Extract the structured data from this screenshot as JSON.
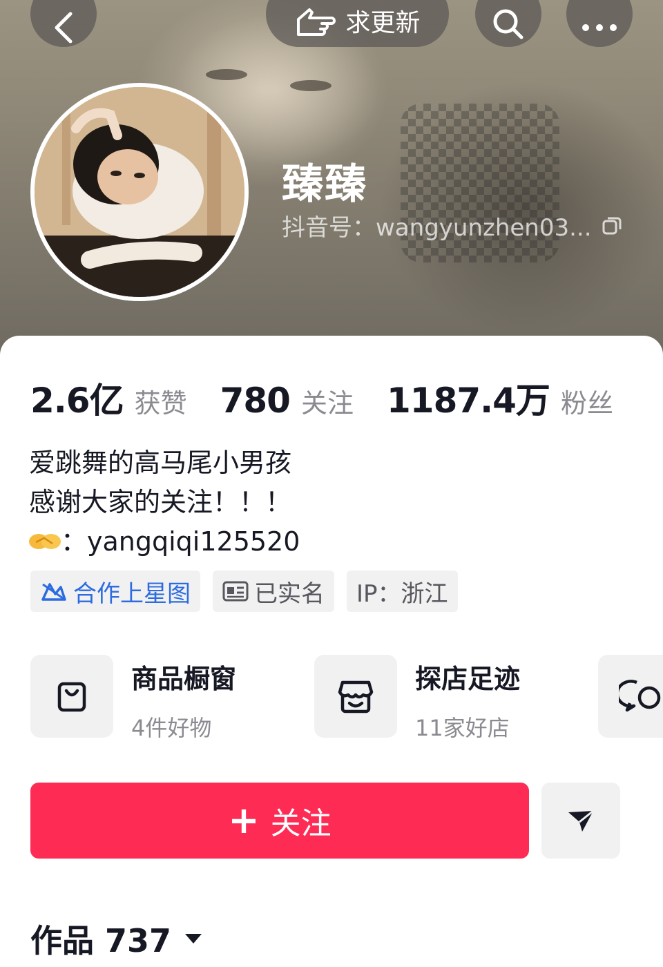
{
  "header": {
    "update_label": "求更新",
    "nickname": "臻臻",
    "douyin_id": "抖音号：wangyunzhen03..."
  },
  "stats": [
    {
      "value": "2.6亿",
      "label": "获赞"
    },
    {
      "value": "780",
      "label": "关注"
    },
    {
      "value": "1187.4万",
      "label": "粉丝"
    }
  ],
  "bio": {
    "line1": "爱跳舞的高马尾小男孩",
    "line2": "感谢大家的关注！！！",
    "line3_separator": "：",
    "line3_contact": "yangqiqi125520"
  },
  "tags": {
    "cooperate": "合作上星图",
    "verified": "已实名",
    "ip": "IP：浙江"
  },
  "shortcuts": {
    "shop": {
      "title": "商品橱窗",
      "subtitle": "4件好物"
    },
    "store": {
      "title": "探店足迹",
      "subtitle": "11家好店"
    }
  },
  "actions": {
    "follow_plus": "+",
    "follow_label": "关注"
  },
  "works": {
    "label": "作品 737"
  },
  "colors": {
    "follow_red": "#fe2c55",
    "link_blue": "#2c6ce0"
  }
}
